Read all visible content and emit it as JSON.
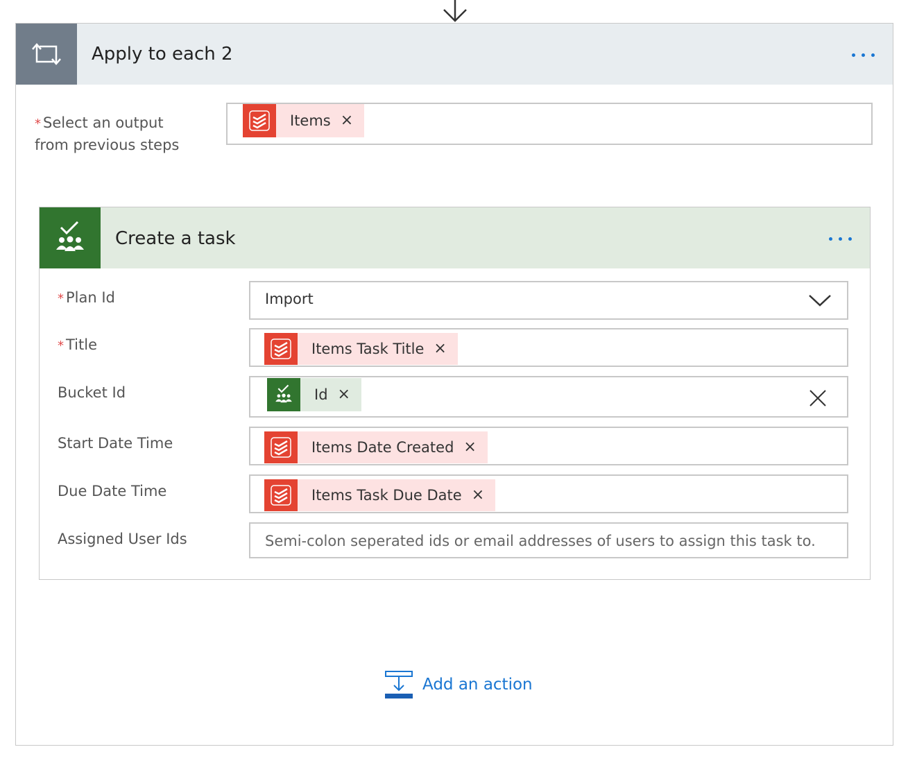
{
  "apply_to_each": {
    "title": "Apply to each 2",
    "select_output_label_line1": "Select an output",
    "select_output_label_line2": "from previous steps",
    "output_token": "Items"
  },
  "create_task": {
    "title": "Create a task",
    "fields": {
      "plan_id": {
        "label": "Plan Id",
        "value": "Import"
      },
      "title": {
        "label": "Title",
        "token": "Items Task Title"
      },
      "bucket_id": {
        "label": "Bucket Id",
        "token": "Id"
      },
      "start_date_time": {
        "label": "Start Date Time",
        "token": "Items Date Created"
      },
      "due_date_time": {
        "label": "Due Date Time",
        "token": "Items Task Due Date"
      },
      "assigned_user_ids": {
        "label": "Assigned User Ids",
        "placeholder": "Semi-colon seperated ids or email addresses of users to assign this task to."
      }
    }
  },
  "add_action": {
    "label": "Add an action"
  },
  "required_marker": "*",
  "token_remove_glyph": "×",
  "colors": {
    "accent": "#1a76d2",
    "todoist_red": "#e44332",
    "planner_green": "#31752f",
    "loop_gray": "#717d8a",
    "todoist_token_bg": "#fde2e2",
    "planner_token_bg": "#e0ebe0"
  },
  "icons": {
    "flow_arrow": "arrow-down-icon",
    "loop": "loop-icon",
    "todoist": "todoist-icon",
    "planner": "planner-icon",
    "more": "more-dots-icon",
    "dropdown": "chevron-down-icon",
    "clear": "clear-icon",
    "add_action": "add-action-icon"
  }
}
